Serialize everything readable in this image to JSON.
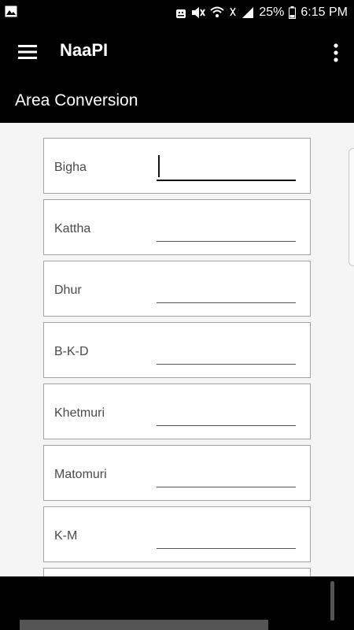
{
  "status_bar": {
    "battery_percent": "25%",
    "time": "6:15 PM",
    "icons": [
      "image-notification-icon",
      "android-icon",
      "mute-icon",
      "wifi-icon",
      "no-sim-icon",
      "signal-icon",
      "battery-icon"
    ]
  },
  "app_bar": {
    "title": "NaaPI",
    "menu_icon": "hamburger-menu-icon",
    "more_icon": "more-vert-icon"
  },
  "section": {
    "title": "Area Conversion"
  },
  "fields": [
    {
      "label": "Bigha",
      "value": "",
      "focused": true
    },
    {
      "label": "Kattha",
      "value": ""
    },
    {
      "label": "Dhur",
      "value": ""
    },
    {
      "label": "B-K-D",
      "value": ""
    },
    {
      "label": "Khetmuri",
      "value": ""
    },
    {
      "label": "Matomuri",
      "value": ""
    },
    {
      "label": "K-M",
      "value": ""
    },
    {
      "label": "",
      "value": ""
    }
  ],
  "colors": {
    "bar_bg": "#000000",
    "content_bg": "#f5f5f5",
    "card_border": "#a3a3a3"
  }
}
